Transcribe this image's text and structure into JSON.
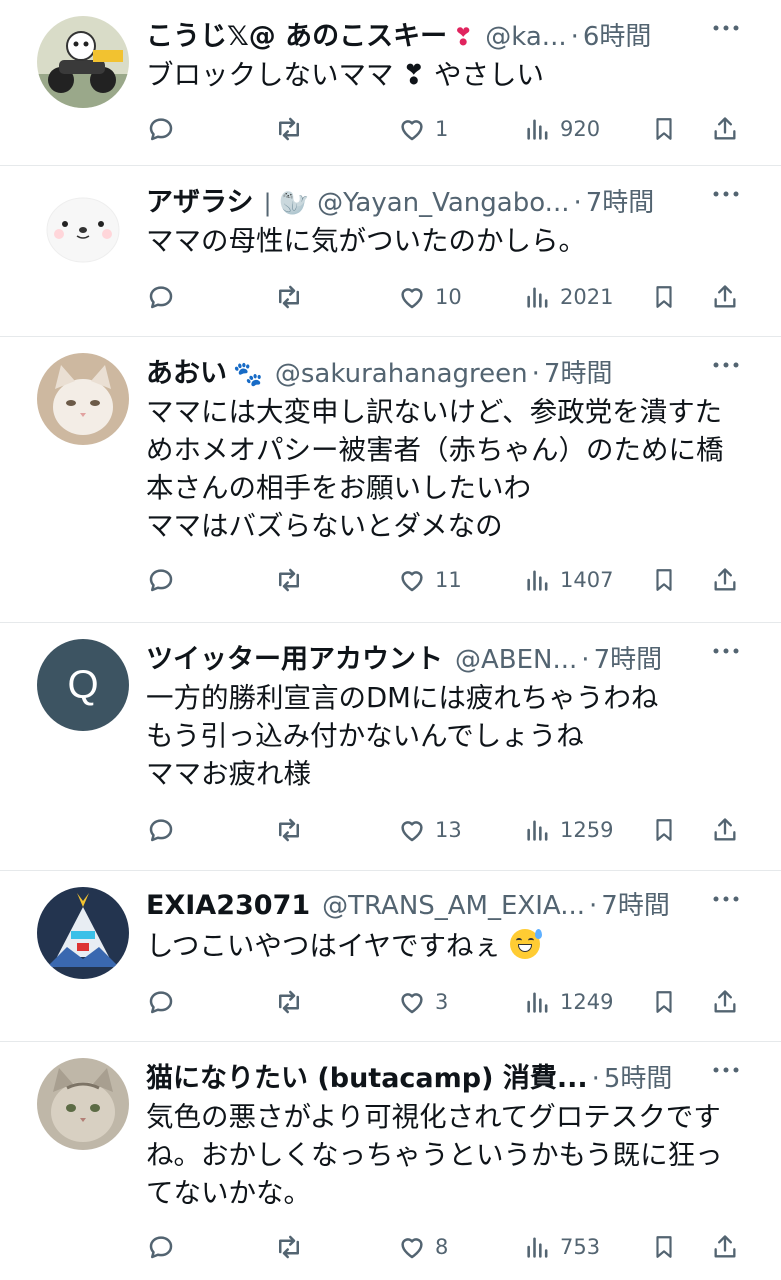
{
  "tweets": [
    {
      "name": "こうじ𝕏@ あのこスキー",
      "badge": "❣",
      "handle": "@ka...",
      "time": "6時間",
      "body": "ブロックしないママ ❣ やさしい",
      "likes": "1",
      "views": "920",
      "avatar_icon": "motorcycle-character-avatar"
    },
    {
      "name": "アザラシ",
      "badge": "| 🦭",
      "handle": "@Yayan_Vangabo...",
      "time": "7時間",
      "body": "ママの母性に気がついたのかしら。",
      "likes": "10",
      "views": "2021",
      "avatar_icon": "white-seal-avatar"
    },
    {
      "name": "あおい",
      "badge": "🐾",
      "handle": "@sakurahanagreen",
      "time": "7時間",
      "body": "ママには大変申し訳ないけど、参政党を潰すためホメオパシー被害者（赤ちゃん）のために橋本さんの相手をお願いしたいわ\nママはバズらないとダメなの",
      "likes": "11",
      "views": "1407",
      "avatar_icon": "cat-avatar"
    },
    {
      "name": "ツイッター用アカウント",
      "badge": "",
      "handle": "@ABEN...",
      "time": "7時間",
      "body": "一方的勝利宣言のDMには疲れちゃうわね\nもう引っ込み付かないんでしょうね\nママお疲れ様",
      "likes": "13",
      "views": "1259",
      "avatar_letter": "Q"
    },
    {
      "name": "EXIA23071",
      "badge": "",
      "handle": "@TRANS_AM_EXIA...",
      "time": "7時間",
      "body": "しつこいやつはイヤですねぇ",
      "likes": "3",
      "views": "1249",
      "avatar_icon": "robot-avatar"
    },
    {
      "name": "猫になりたい (butacamp) 消費...",
      "badge": "",
      "handle": "",
      "time": "5時間",
      "body": "気色の悪さがより可視化されてグロテスクですね。おかしくなっちゃうというかもう既に狂ってないかな。",
      "likes": "8",
      "views": "753",
      "avatar_icon": "tabby-cat-avatar"
    }
  ],
  "dot": "·",
  "colors": {
    "secondary": "#536471",
    "text": "#0f1419",
    "divider": "#e6e9eb"
  }
}
